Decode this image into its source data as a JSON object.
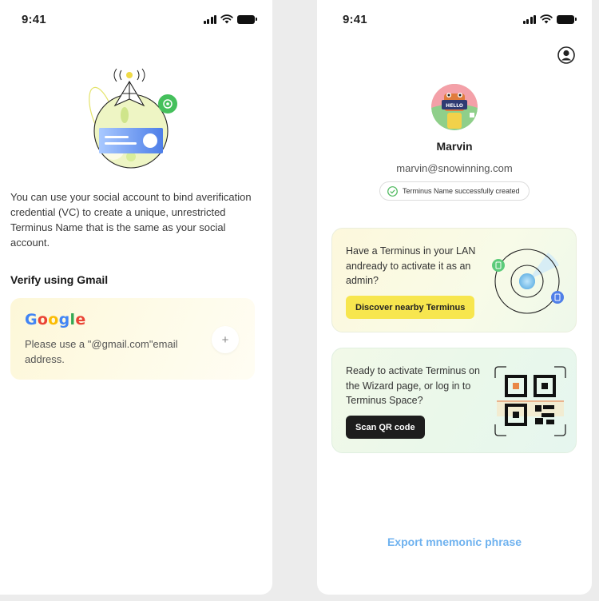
{
  "left_screen": {
    "status": {
      "time": "9:41"
    },
    "description": "You can use your social account to bind averification credential (VC) to create a unique, unrestricted Terminus Name that is the same as your social account.",
    "heading": "Verify using Gmail",
    "gmail_card": {
      "logo_text": "Google",
      "text": "Please use a \"@gmail.com\"email address.",
      "add_button_label": "+"
    }
  },
  "right_screen": {
    "status": {
      "time": "9:41"
    },
    "profile": {
      "name": "Marvin",
      "email": "marvin@snowinning.com",
      "status_chip": "Terminus Name successfully created",
      "avatar_sign": "HELLO"
    },
    "lan_card": {
      "text": "Have a Terminus in your LAN andready to activate it as an admin?",
      "button": "Discover nearby Terminus"
    },
    "qr_card": {
      "text": "Ready to activate Terminus on the Wizard page, or log in to Terminus Space?",
      "button": "Scan QR code"
    },
    "export_link": "Export mnemonic phrase"
  },
  "colors": {
    "accent_yellow": "#f7e64e",
    "success_green": "#4cb85c",
    "link_blue": "#6fb2ef",
    "dark_button": "#1d1d1d"
  },
  "icons": [
    "signal-icon",
    "wifi-icon",
    "battery-icon",
    "profile-icon",
    "check-circle-icon",
    "plus-icon",
    "gear-icon"
  ]
}
